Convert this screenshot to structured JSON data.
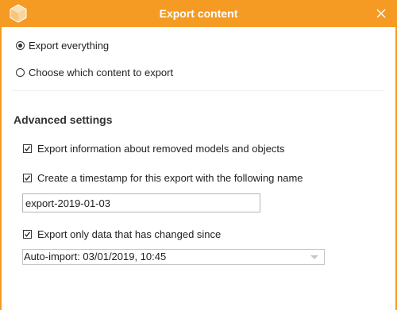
{
  "window": {
    "title": "Export content",
    "accent_color": "#f59a23",
    "app_icon": "cube-icon",
    "close_icon": "close-icon"
  },
  "scope": {
    "options": [
      {
        "label": "Export everything",
        "selected": true
      },
      {
        "label": "Choose which content to export",
        "selected": false
      }
    ]
  },
  "advanced": {
    "title": "Advanced settings",
    "removed_objects": {
      "label": "Export information about removed models and objects",
      "checked": true
    },
    "timestamp": {
      "label": "Create a timestamp for this export with the following name",
      "checked": true,
      "value": "export-2019-01-03"
    },
    "changed_since": {
      "label": "Export only data that has changed since",
      "checked": true,
      "selected_value": "Auto-import: 03/01/2019, 10:45"
    }
  }
}
